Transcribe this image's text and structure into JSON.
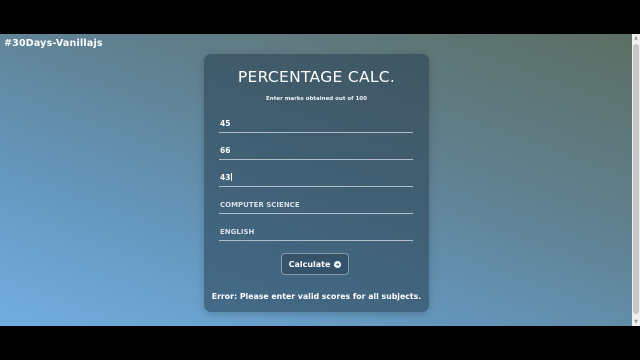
{
  "brand": "#30Days-Vanillajs",
  "card": {
    "title": "PERCENTAGE CALC.",
    "subtitle": "Enter marks obtained out of 100",
    "fields": [
      {
        "value": "45",
        "placeholder": ""
      },
      {
        "value": "66",
        "placeholder": ""
      },
      {
        "value": "43",
        "placeholder": ""
      },
      {
        "value": "",
        "placeholder": "COMPUTER SCIENCE"
      },
      {
        "value": "",
        "placeholder": "ENGLISH"
      }
    ],
    "button_label": "Calculate",
    "error_text": "Error: Please enter valid scores for all subjects."
  },
  "colors": {
    "background_start": "#72aee0",
    "background_end": "#5c6e62",
    "card": "#263e50",
    "text": "#ffffff"
  },
  "icons": {
    "button_icon": "arrow-right-circle-icon"
  }
}
